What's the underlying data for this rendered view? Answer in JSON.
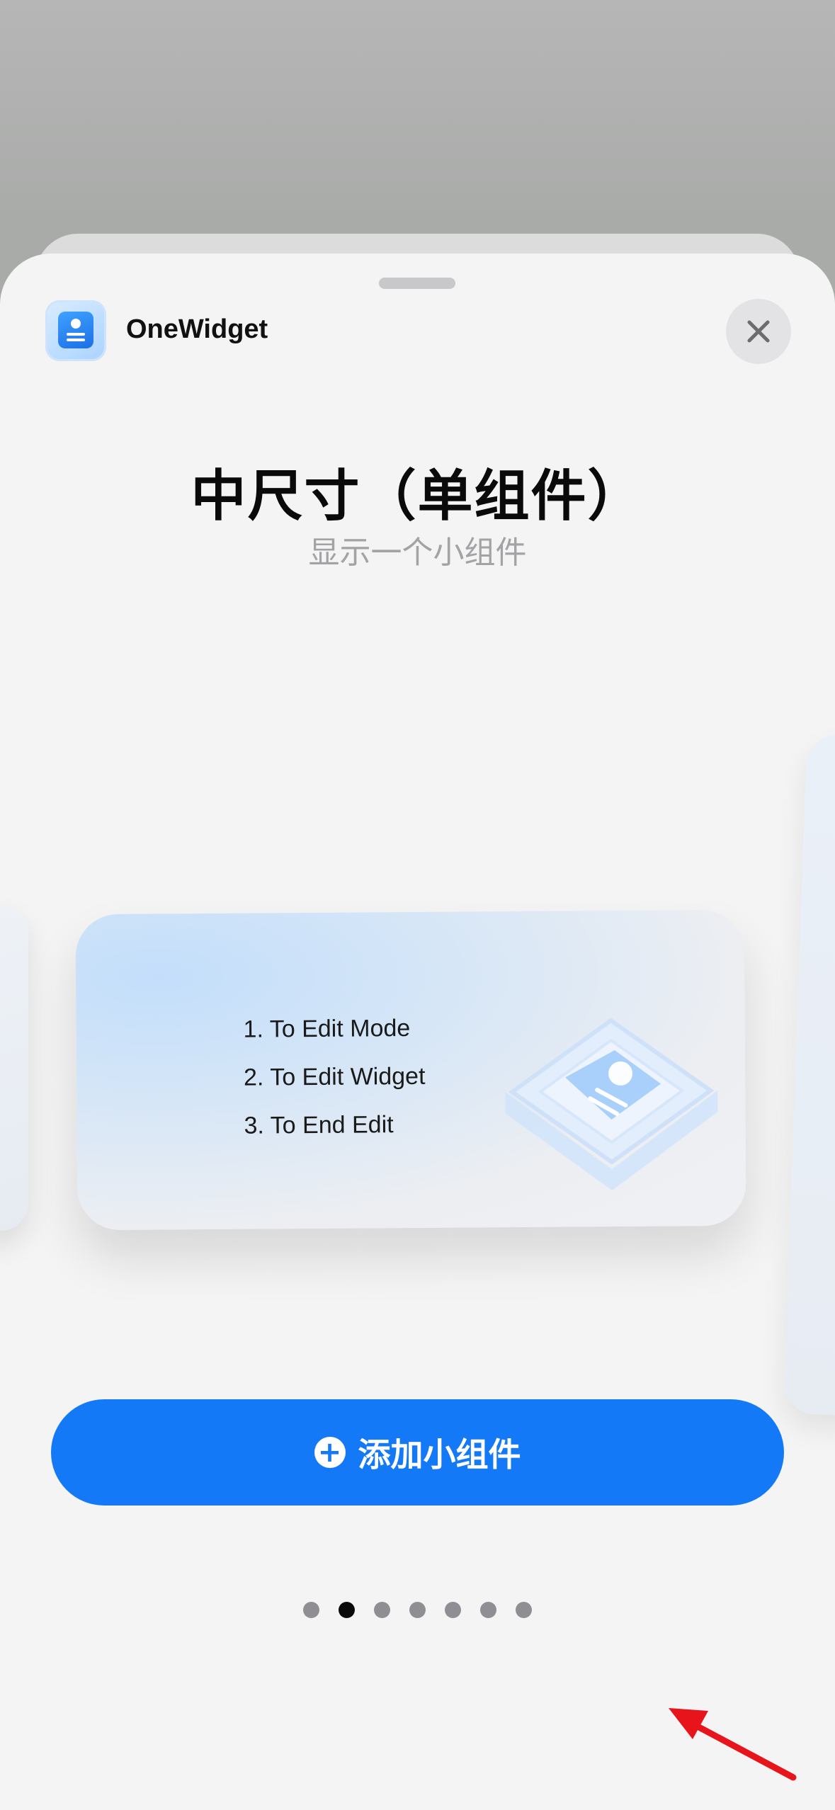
{
  "app": {
    "name": "OneWidget",
    "icon": "onewidget-app-icon"
  },
  "header": {
    "title": "中尺寸（单组件）",
    "subtitle": "显示一个小组件"
  },
  "widget_preview": {
    "steps": [
      "1. To Edit Mode",
      "2. To Edit Widget",
      "3. To End Edit"
    ]
  },
  "pagination": {
    "total": 7,
    "active_index": 1
  },
  "add_button": {
    "label": "添加小组件",
    "icon": "plus-circle-icon"
  },
  "colors": {
    "accent": "#1479f7",
    "annotation_arrow": "#e8141b"
  }
}
